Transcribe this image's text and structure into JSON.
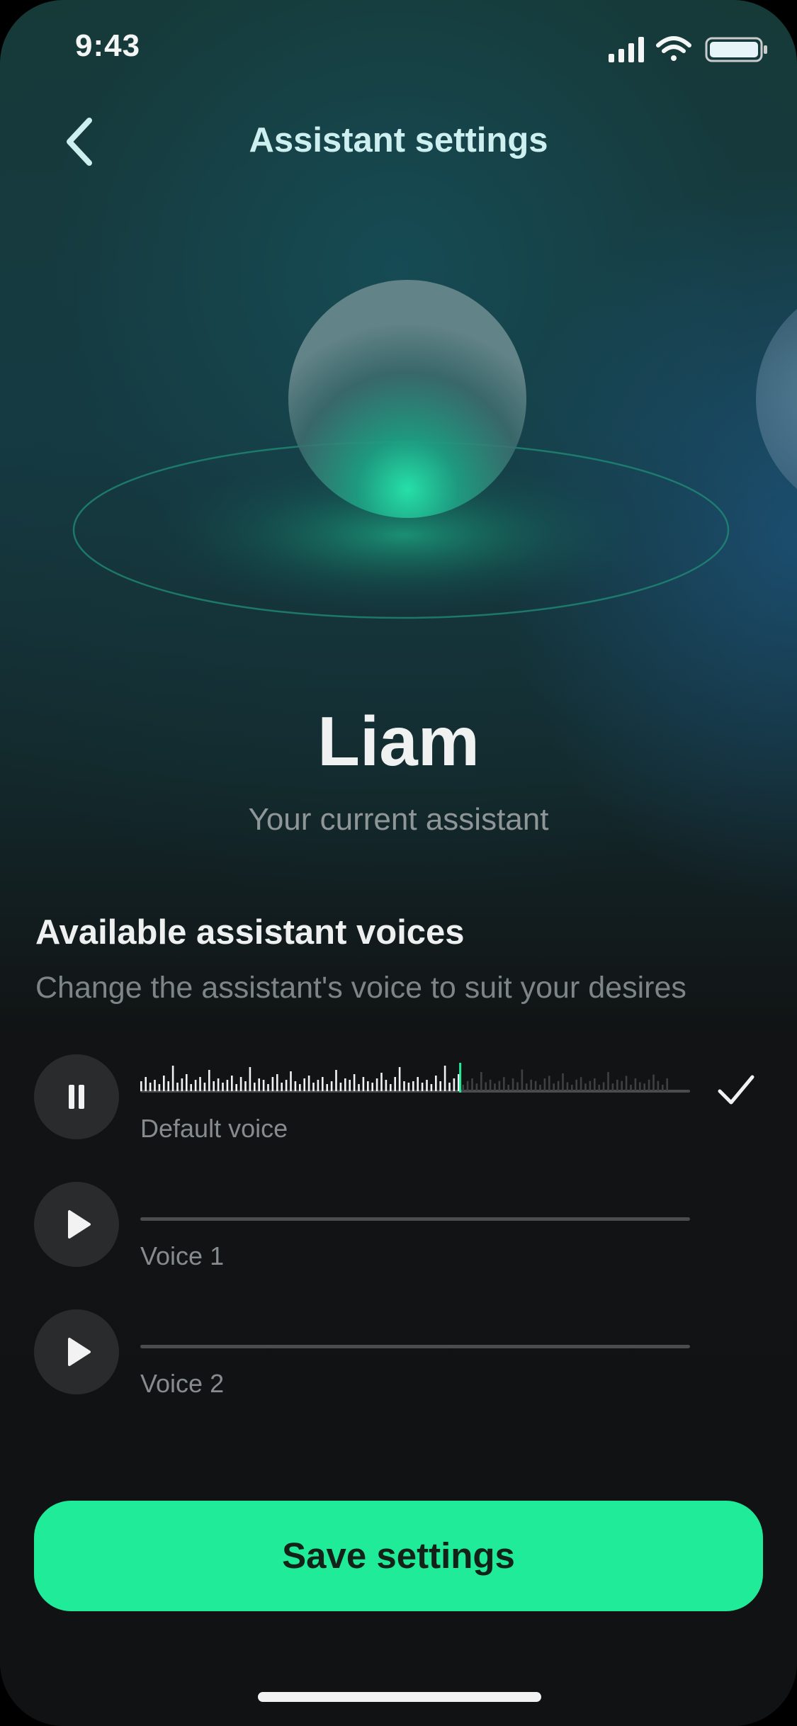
{
  "status_bar": {
    "time": "9:43"
  },
  "header": {
    "title": "Assistant settings"
  },
  "assistant": {
    "name": "Liam",
    "subtitle": "Your current assistant"
  },
  "voices_section": {
    "title": "Available assistant voices",
    "description": "Change the assistant's voice to suit your desires",
    "voices": [
      {
        "label": "Default voice",
        "state": "playing",
        "selected": true,
        "progress": 0.58
      },
      {
        "label": "Voice 1",
        "state": "paused",
        "selected": false,
        "progress": 0
      },
      {
        "label": "Voice 2",
        "state": "paused",
        "selected": false,
        "progress": 0
      }
    ]
  },
  "footer": {
    "save_label": "Save settings"
  },
  "colors": {
    "accent": "#1feb98",
    "title": "#cdeff0",
    "background": "#111213"
  }
}
